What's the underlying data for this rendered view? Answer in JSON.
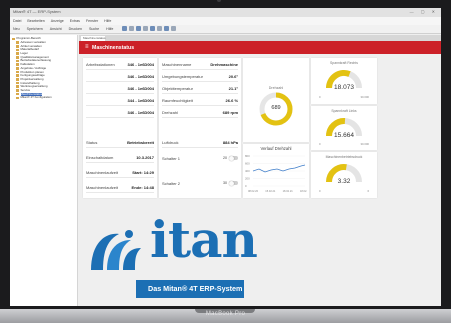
{
  "device": {
    "model": "MacBook Pro"
  },
  "window": {
    "title": "Mitan® 4T — ERP-System",
    "controls": "—  ▢  ✕"
  },
  "menu": [
    "Datei",
    "Bearbeiten",
    "Anzeige",
    "Extras",
    "Fenster",
    "Hilfe"
  ],
  "toolbar": [
    "Neu",
    "Speichern",
    "Ansicht",
    "Drucken",
    "Suche",
    "Hilfe"
  ],
  "tree": [
    {
      "label": "Programm-Bereich",
      "indent": false,
      "selected": false
    },
    {
      "label": "Adressen verwalten",
      "indent": true,
      "selected": false
    },
    {
      "label": "Artikel verwalten",
      "indent": true,
      "selected": false
    },
    {
      "label": "Materialbedarf",
      "indent": true,
      "selected": false
    },
    {
      "label": "Lager",
      "indent": true,
      "selected": false
    },
    {
      "label": "Qualitätsmanagement",
      "indent": true,
      "selected": false
    },
    {
      "label": "Betriebsdatenerfassung",
      "indent": true,
      "selected": false
    },
    {
      "label": "Kalkulation",
      "indent": true,
      "selected": false
    },
    {
      "label": "Angebote / Aufträge",
      "indent": true,
      "selected": false
    },
    {
      "label": "Produktion planen",
      "indent": true,
      "selected": false
    },
    {
      "label": "Fertigungsaufträge",
      "indent": true,
      "selected": false
    },
    {
      "label": "Projektverwaltung",
      "indent": true,
      "selected": false
    },
    {
      "label": "Instandhaltung",
      "indent": true,
      "selected": false
    },
    {
      "label": "Werkzeugverwaltung",
      "indent": true,
      "selected": false
    },
    {
      "label": "Service",
      "indent": true,
      "selected": false
    },
    {
      "label": "Maschinenstatus",
      "indent": true,
      "selected": true
    },
    {
      "label": "Mitan® 4T Konfiguration",
      "indent": true,
      "selected": false
    }
  ],
  "app_tab": "Maschinenstatus",
  "header": {
    "title": "Maschinenstatus"
  },
  "card1": {
    "rows": [
      {
        "label": "Arbeitsstationen",
        "value": "346 - 1e6D004"
      },
      {
        "label": "",
        "value": "346 - 1e6D004"
      },
      {
        "label": "",
        "value": "346 - 1e6D004"
      },
      {
        "label": "",
        "value": "344 - 1e6D004"
      },
      {
        "label": "",
        "value": "346 - 1e6D004"
      }
    ],
    "status_rows": [
      {
        "label": "Status",
        "value": "Betriebsbereit"
      },
      {
        "label": "Einschaltdatum",
        "value": "10.3.2017"
      },
      {
        "label": "Maschinenlaufzeit",
        "value": "Start: 14:29"
      },
      {
        "label": "Maschinenlaufzeit",
        "value": "Ende: 14:48"
      }
    ]
  },
  "card2": {
    "rows": [
      {
        "label": "Maschinenname",
        "value": "Drehmaschine"
      },
      {
        "label": "Umgebungstemperatur",
        "value": "20.6°"
      },
      {
        "label": "Objekttemperatur",
        "value": "21.1°"
      },
      {
        "label": "Raumfeuchtigkeit",
        "value": "26.6 %"
      },
      {
        "label": "Drehzahl",
        "value": "689 rpm"
      }
    ],
    "luftdruck": {
      "label": "Luftdruck",
      "value": "884 hPa"
    },
    "switches": [
      {
        "label": "Schalter 1",
        "value": "20"
      },
      {
        "label": "Schalter 2",
        "value": "30"
      }
    ]
  },
  "drehzahl_widget": {
    "title": "Drehzahl",
    "value": "689",
    "fraction": 0.69
  },
  "line_chart": {
    "title": "Verlauf Drehzahl",
    "y_ticks": [
      "800",
      "600",
      "400",
      "200",
      "0"
    ],
    "x_ticks": [
      "08.02.20",
      "15.02.21",
      "18.02.21",
      "18.02.22"
    ]
  },
  "gauges": [
    {
      "title": "Spannkraft Rechts",
      "value": "18.073",
      "fraction": 0.62,
      "min": "0",
      "max": "30.000",
      "color": "#e3c212"
    },
    {
      "title": "Spannkraft Links",
      "value": "15.664",
      "fraction": 0.52,
      "min": "0",
      "max": "30.000",
      "color": "#e3c212"
    },
    {
      "title": "Maschinenbetriebsdruck",
      "value": "3.32",
      "fraction": 0.55,
      "min": "0",
      "max": "6",
      "color": "#e3c212"
    }
  ],
  "brand": {
    "name": "itan",
    "slogan": "Das Mitan® 4T ERP-System",
    "color": "#1c6fb4"
  },
  "colors": {
    "header": "#cc2128",
    "accent_yellow": "#e3c212",
    "chart_line": "#3d7cc9"
  }
}
